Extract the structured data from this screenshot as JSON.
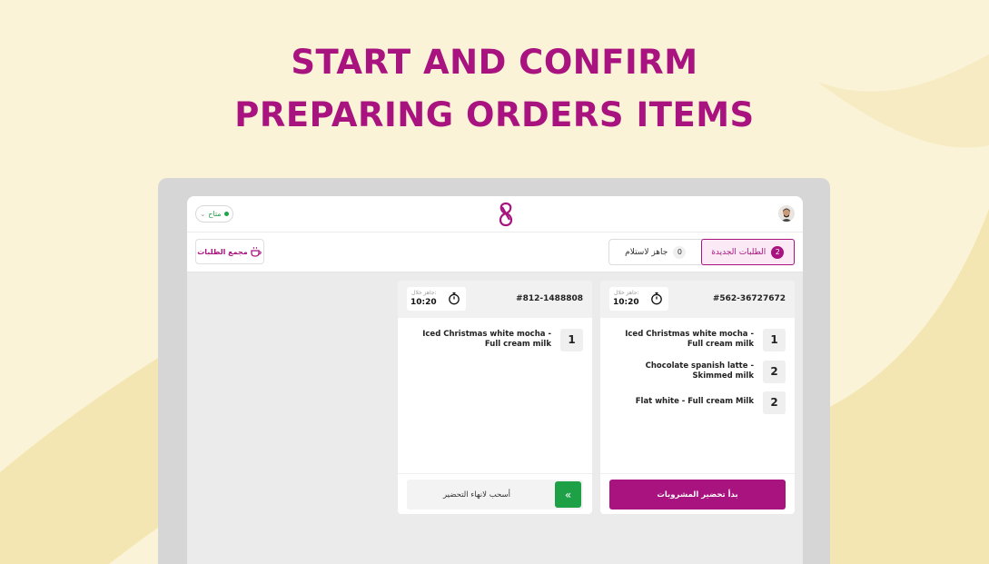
{
  "headline": {
    "line1": "START AND CONFIRM",
    "line2": "PREPARING ORDERS ITEMS"
  },
  "colors": {
    "brand": "#a8137f",
    "background": "#fbf3d7",
    "success": "#1ea046"
  },
  "topbar": {
    "status_label": "متاح",
    "logo_icon": "brand-logo-icon",
    "avatar_icon": "user-avatar-icon"
  },
  "subbar": {
    "collect_label": "مجمع الطلبات",
    "tabs": [
      {
        "label": "الطلبات الجديدة",
        "count": "2"
      },
      {
        "label": "جاهز لاستلام",
        "count": "0"
      }
    ]
  },
  "orders": [
    {
      "id": "#562-36727672",
      "ready_in_label": "جاهز خلال:",
      "ready_time": "10:20",
      "items": [
        {
          "name": "Iced Christmas white mocha - Full cream milk",
          "qty": "1"
        },
        {
          "name": "Chocolate spanish latte - Skimmed milk",
          "qty": "2"
        },
        {
          "name": "Flat white - Full cream Milk",
          "qty": "2"
        }
      ],
      "action_label": "بدأ تحضير المشروبات"
    },
    {
      "id": "#812-1488808",
      "ready_in_label": "جاهز خلال:",
      "ready_time": "10:20",
      "items": [
        {
          "name": "Iced Christmas white mocha - Full cream milk",
          "qty": "1"
        }
      ],
      "action_label": "أسحب لانهاء التحضير"
    }
  ]
}
